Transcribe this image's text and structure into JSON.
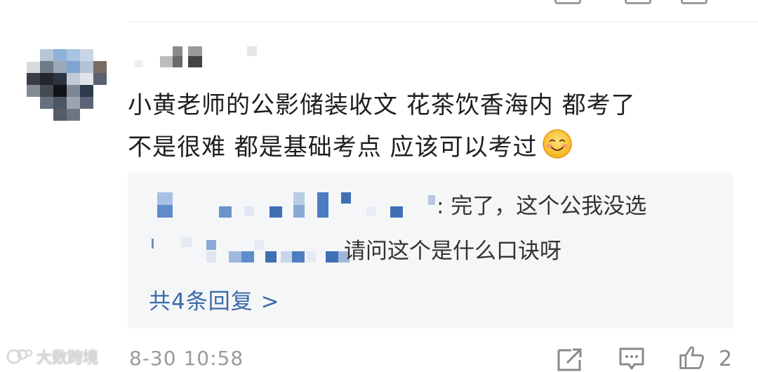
{
  "comment": {
    "text_line1": "小黄老师的公影储装收文 花茶饮香海内 都考了",
    "text_line2": "不是很难 都是基础考点 应该可以考过",
    "emoji": "smile-emoji"
  },
  "replies": [
    {
      "text": ": 完了，这个公我没选"
    },
    {
      "text": "请问这个是什么口诀呀"
    }
  ],
  "more_replies_label": "共4条回复 >",
  "footer": {
    "watermark": "大数跨境",
    "timestamp": "8-30 10:58",
    "like_count": "2"
  },
  "colors": {
    "link": "#3d6aa8",
    "reply_bg": "#f5f6f8",
    "blur_blue": "#3f6fb5"
  }
}
